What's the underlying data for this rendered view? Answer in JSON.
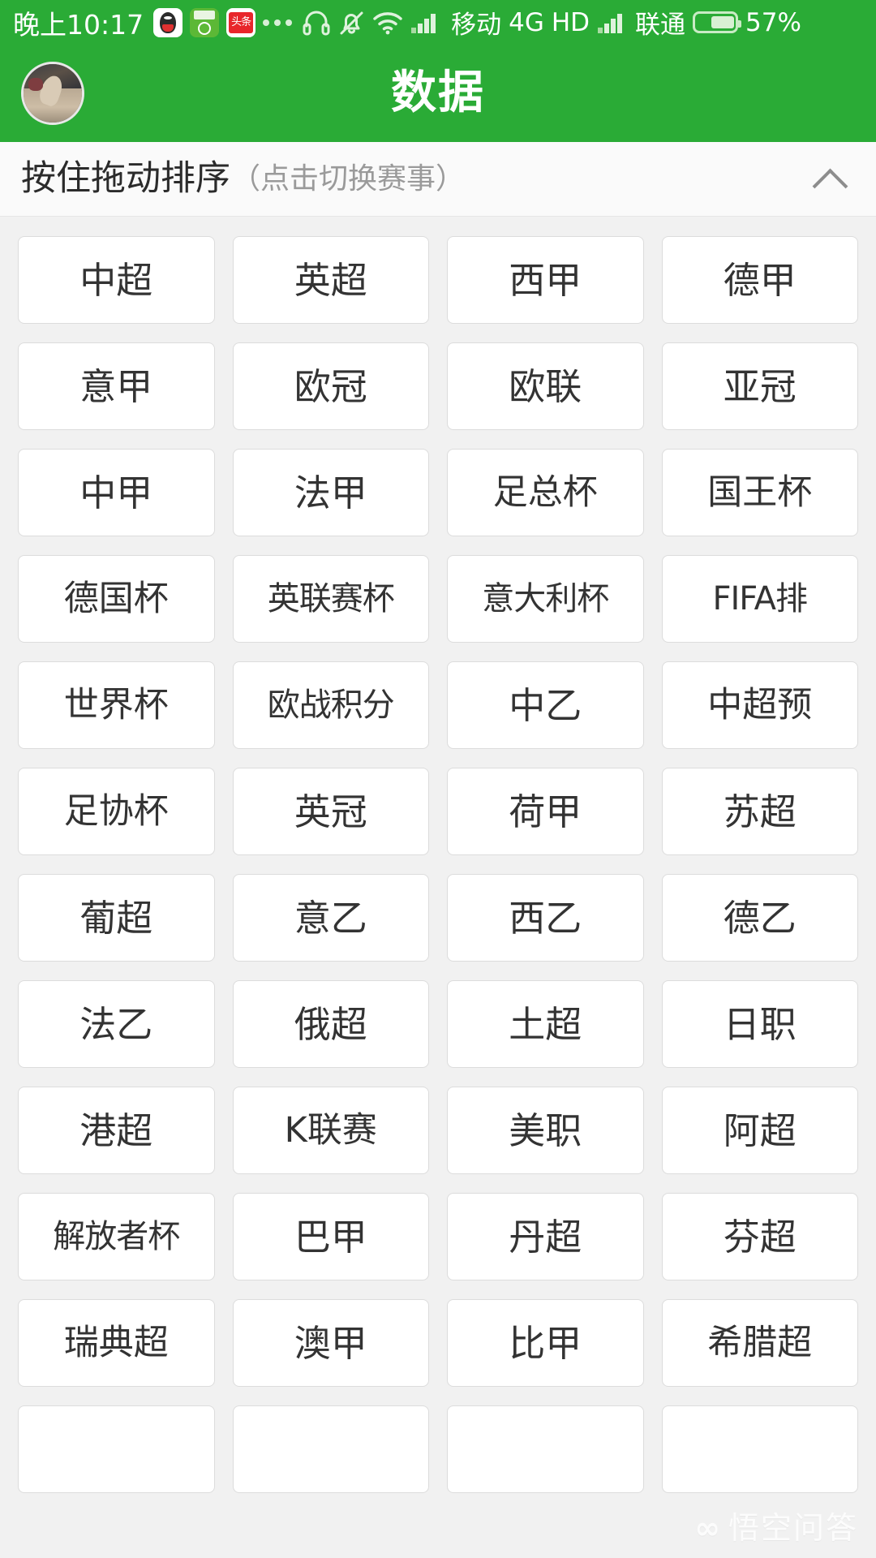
{
  "theme": {
    "brand_green": "#2aab36",
    "page_bg": "#f1f1f1",
    "tile_bg": "#ffffff",
    "tile_border": "#dcdcdc",
    "text_dark": "#333333",
    "text_muted": "#9a9a9a"
  },
  "status_bar": {
    "clock": "晚上10:17",
    "app_icons": [
      {
        "name": "qq-icon",
        "label": "QQ"
      },
      {
        "name": "green-app-icon",
        "label": "球探"
      },
      {
        "name": "toutiao-icon",
        "label": "头条"
      }
    ],
    "overflow_dots": "•••",
    "icons": [
      {
        "name": "headset-icon"
      },
      {
        "name": "bell-muted-icon"
      },
      {
        "name": "wifi-icon"
      },
      {
        "name": "signal-bars-icon"
      },
      {
        "name": "signal-bars-secondary-icon"
      }
    ],
    "carrier_primary": "移动",
    "network_type": "4G",
    "volte": "HD",
    "carrier_secondary": "联通",
    "battery_percent": "57%",
    "battery_level": 57
  },
  "title_bar": {
    "title": "数据",
    "avatar": "user-avatar"
  },
  "section_header": {
    "main_label": "按住拖动排序",
    "sub_label": "（点击切换赛事）",
    "collapse_icon": "chevron-up-icon"
  },
  "leagues": [
    "中超",
    "英超",
    "西甲",
    "德甲",
    "意甲",
    "欧冠",
    "欧联",
    "亚冠",
    "中甲",
    "法甲",
    "足总杯",
    "国王杯",
    "德国杯",
    "英联赛杯",
    "意大利杯",
    "FIFA排",
    "世界杯",
    "欧战积分",
    "中乙",
    "中超预",
    "足协杯",
    "英冠",
    "荷甲",
    "苏超",
    "葡超",
    "意乙",
    "西乙",
    "德乙",
    "法乙",
    "俄超",
    "土超",
    "日职",
    "港超",
    "K联赛",
    "美职",
    "阿超",
    "解放者杯",
    "巴甲",
    "丹超",
    "芬超",
    "瑞典超",
    "澳甲",
    "比甲",
    "希腊超",
    "",
    "",
    "",
    ""
  ],
  "watermark": {
    "glyph": "∞",
    "text": "悟空问答"
  }
}
